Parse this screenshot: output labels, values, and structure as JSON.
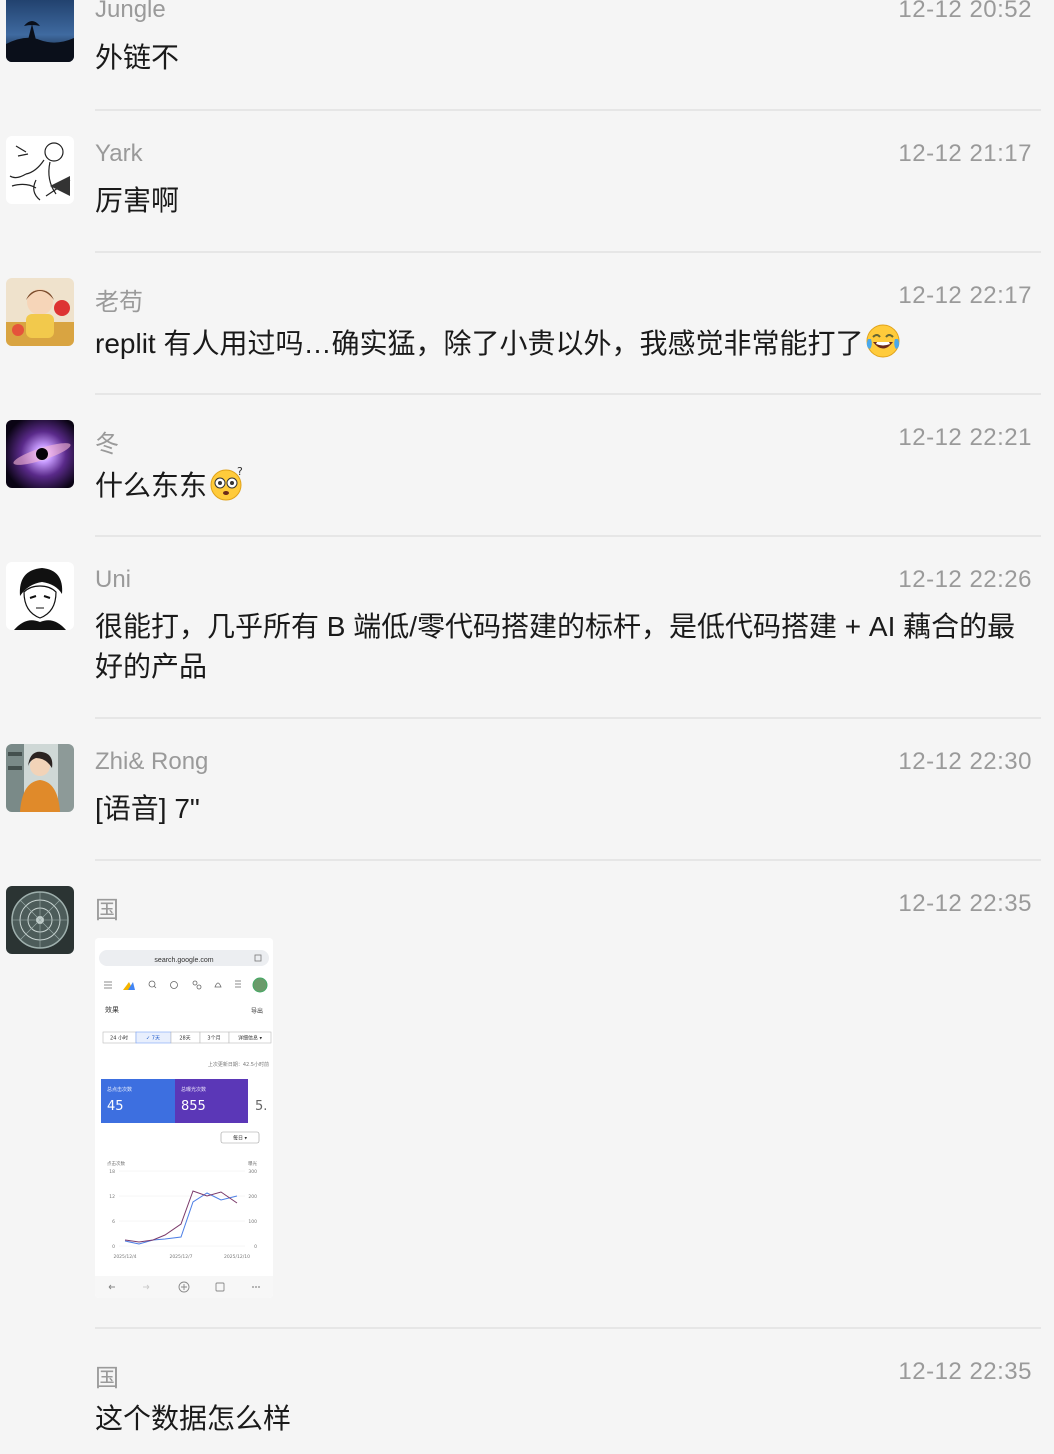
{
  "messages": [
    {
      "sender": "Jungle",
      "time": "12-12 20:52",
      "text": "外链不"
    },
    {
      "sender": "Yark",
      "time": "12-12 21:17",
      "text": "厉害啊"
    },
    {
      "sender": "老苟",
      "time": "12-12 22:17",
      "text": "replit 有人用过吗…确实猛，除了小贵以外，我感觉非常能打了",
      "emoji": "tears-of-joy-emoji"
    },
    {
      "sender": "冬",
      "time": "12-12 22:21",
      "text": "什么东东",
      "emoji": "dizzy-face-emoji"
    },
    {
      "sender": "Uni",
      "time": "12-12 22:26",
      "text": "很能打，几乎所有 B  端低/零代码搭建的标杆，是低代码搭建 + AI 藕合的最好的产品"
    },
    {
      "sender": "Zhi& Rong",
      "time": "12-12 22:30",
      "text": "[语音] 7\""
    },
    {
      "sender": "国",
      "time": "12-12 22:35",
      "image": {
        "url": "search.google.com",
        "section": "效果",
        "export": "导出",
        "ranges": [
          "24 小时",
          "✓ 7天",
          "28天",
          "3个月",
          "详细信息 ▾"
        ],
        "updated": "上次更新日期：42.5小时前",
        "metrics": [
          {
            "label": "总点击次数",
            "value": "45",
            "color": "#3d6fe0"
          },
          {
            "label": "总曝光次数",
            "value": "855",
            "color": "#5b37b7"
          },
          {
            "label": "",
            "value": "5."
          }
        ],
        "granularity": "每日 ▾",
        "left_axis_label": "点击次数",
        "right_axis_label": "曝光",
        "left_ticks": [
          "18",
          "12",
          "6",
          "0"
        ],
        "right_ticks": [
          "300",
          "200",
          "100",
          "0"
        ],
        "x_ticks": [
          "2025/12/4",
          "2025/12/7",
          "2025/12/10"
        ]
      }
    },
    {
      "sender": "国",
      "time": "12-12 22:35",
      "text": "这个数据怎么样"
    }
  ],
  "colors": {
    "background": "#f5f5f5",
    "meta": "#9a9a9a",
    "text": "#1a1a1a",
    "divider": "#e6e6e6"
  }
}
